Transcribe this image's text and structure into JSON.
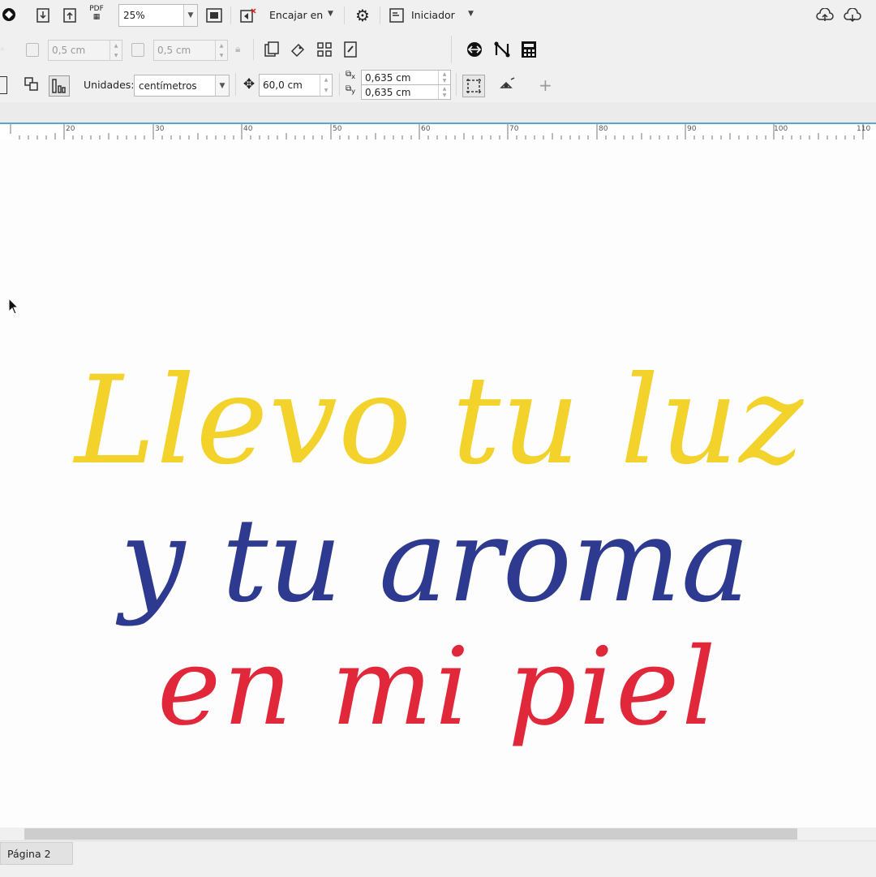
{
  "toolbar_top": {
    "zoom_value": "25%",
    "fit_label": "Encajar en",
    "launcher_label": "Iniciador",
    "pdf_label": "PDF"
  },
  "toolbar_mid": {
    "width_value": "0,5 cm",
    "height_value": "0,5 cm"
  },
  "toolbar_bottom": {
    "units_label": "Unidades:",
    "units_value": "centímetros",
    "nudge_value": "60,0 cm",
    "dup_x_value": "0,635 cm",
    "dup_y_value": "0,635 cm"
  },
  "ruler": {
    "ticks": [
      "20",
      "30",
      "40",
      "50",
      "60",
      "70",
      "80",
      "90",
      "100",
      "110"
    ]
  },
  "canvas": {
    "line1": "Llevo tu luz",
    "line2": "y tu aroma",
    "line3": "en mi piel",
    "colors": {
      "line1": "#f2d22b",
      "line2": "#2e3a8f",
      "line3": "#e0283a"
    }
  },
  "status": {
    "page_tab": "Página 2"
  },
  "icons": [
    "corel-logo-icon",
    "import-icon",
    "export-icon",
    "publish-pdf-icon",
    "full-screen-icon",
    "snap-icon",
    "settings-gear-icon",
    "launcher-icon",
    "cloud-upload-icon",
    "cloud-download-icon",
    "lock-ratio-icon",
    "all-pages-icon",
    "current-page-icon",
    "units-icon",
    "nudge-icon",
    "duplicate-distance-icon",
    "page-border-icon",
    "add-page-icon",
    "quick-customize-icon",
    "mouse-pointer-icon"
  ]
}
